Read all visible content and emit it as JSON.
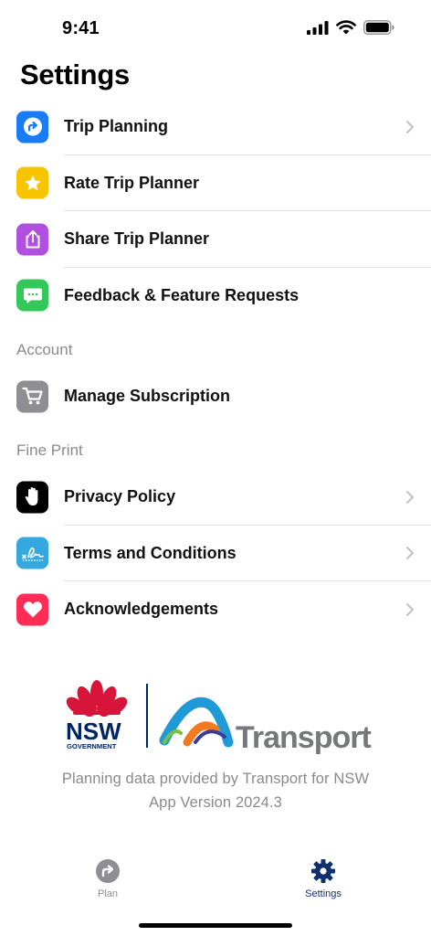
{
  "status": {
    "time": "9:41"
  },
  "page": {
    "title": "Settings"
  },
  "general": [
    {
      "label": "Trip Planning",
      "icon": "trip-planning-icon",
      "color": "#1a7cf5",
      "chevron": true
    },
    {
      "label": "Rate Trip Planner",
      "icon": "star-icon",
      "color": "#f7c500",
      "chevron": false
    },
    {
      "label": "Share Trip Planner",
      "icon": "share-icon",
      "color": "#b04fe0",
      "chevron": false
    },
    {
      "label": "Feedback & Feature Requests",
      "icon": "message-icon",
      "color": "#34c759",
      "chevron": false
    }
  ],
  "account": {
    "header": "Account",
    "items": [
      {
        "label": "Manage Subscription",
        "icon": "cart-icon",
        "color": "#8e8e93",
        "chevron": false
      }
    ]
  },
  "fine_print": {
    "header": "Fine Print",
    "items": [
      {
        "label": "Privacy Policy",
        "icon": "hand-icon",
        "color": "#000000",
        "chevron": true
      },
      {
        "label": "Terms and Conditions",
        "icon": "signature-icon",
        "color": "#35a8e0",
        "chevron": true
      },
      {
        "label": "Acknowledgements",
        "icon": "heart-icon",
        "color": "#ff2d55",
        "chevron": true
      }
    ]
  },
  "logo": {
    "nsw_line1": "NSW",
    "nsw_line2": "GOVERNMENT",
    "transport": "Transport"
  },
  "footer": {
    "line1": "Planning data provided by Transport for NSW",
    "line2": "App Version 2024.3"
  },
  "tabs": [
    {
      "label": "Plan",
      "icon": "plan-icon",
      "active": false
    },
    {
      "label": "Settings",
      "icon": "gear-icon",
      "active": true
    }
  ],
  "colors": {
    "accent": "#10306b",
    "inactive": "#8e8e93",
    "separator": "#e4e4e6"
  }
}
